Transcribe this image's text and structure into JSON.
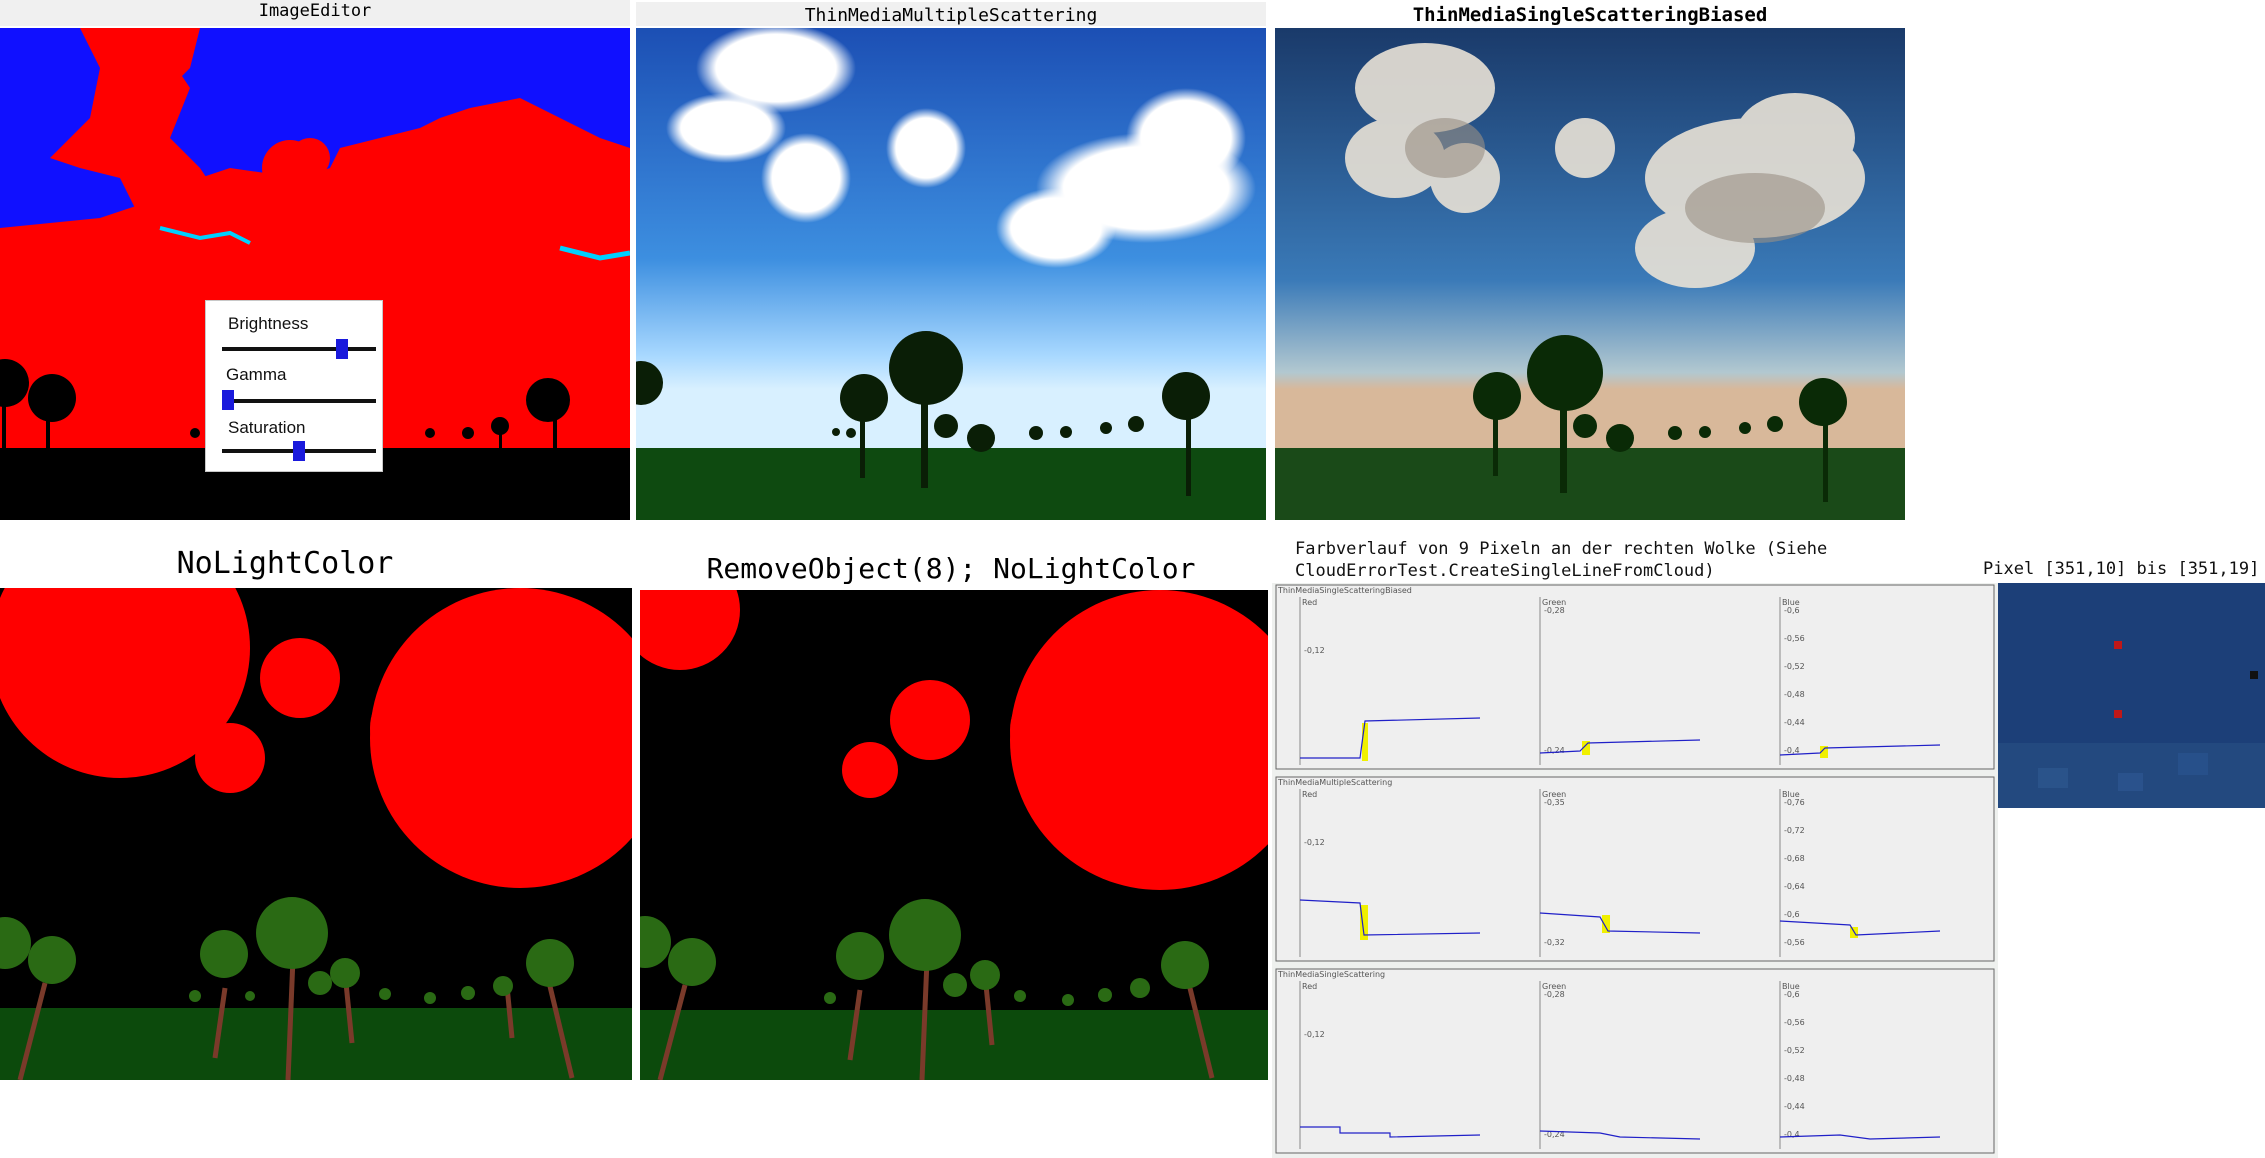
{
  "panels": {
    "top_left_title": "ImageEditor",
    "top_mid_title": "ThinMediaMultipleScattering",
    "top_right_title": "ThinMediaSingleScatteringBiased",
    "bottom_left_title": "NoLightColor",
    "bottom_mid_title": "RemoveObject(8); NoLightColor"
  },
  "image_editor": {
    "brightness_label": "Brightness",
    "gamma_label": "Gamma",
    "saturation_label": "Saturation",
    "brightness_value": 0.8,
    "gamma_value": 0.0,
    "saturation_value": 0.5
  },
  "analysis": {
    "caption_line1": "Farbverlauf von 9 Pixeln an der rechten Wolke (Siehe",
    "caption_line2": "CloudErrorTest.CreateSingleLineFromCloud)",
    "pixel_caption": "Pixel [351,10] bis [351,19]",
    "rows": [
      {
        "title": "ThinMediaSingleScatteringBiased",
        "cols": [
          {
            "label": "Red",
            "ticks": [
              "0,12"
            ]
          },
          {
            "label": "Green",
            "ticks": [
              "0,28",
              "0,24"
            ]
          },
          {
            "label": "Blue",
            "ticks": [
              "0,6",
              "0,56",
              "0,52",
              "0,48",
              "0,44",
              "0,4"
            ]
          }
        ]
      },
      {
        "title": "ThinMediaMultipleScattering",
        "cols": [
          {
            "label": "Red",
            "ticks": [
              "0,12"
            ]
          },
          {
            "label": "Green",
            "ticks": [
              "0,35",
              "0,32"
            ]
          },
          {
            "label": "Blue",
            "ticks": [
              "0,76",
              "0,72",
              "0,68",
              "0,64",
              "0,6",
              "0,56"
            ]
          }
        ]
      },
      {
        "title": "ThinMediaSingleScattering",
        "cols": [
          {
            "label": "Red",
            "ticks": [
              "0,12"
            ]
          },
          {
            "label": "Green",
            "ticks": [
              "0,28",
              "0,24"
            ]
          },
          {
            "label": "Blue",
            "ticks": [
              "0,6",
              "0,56",
              "0,52",
              "0,48",
              "0,44",
              "0,4"
            ]
          }
        ]
      }
    ]
  },
  "colors": {
    "cloud_red": "#ff0000",
    "sky_blue": "#1a1aff",
    "tree_green": "#2a6a14",
    "ground_green": "#0c4a0c",
    "plot_line": "#2020c8",
    "highlight": "#f0f000",
    "pixel_panel": "#1c3f78"
  }
}
